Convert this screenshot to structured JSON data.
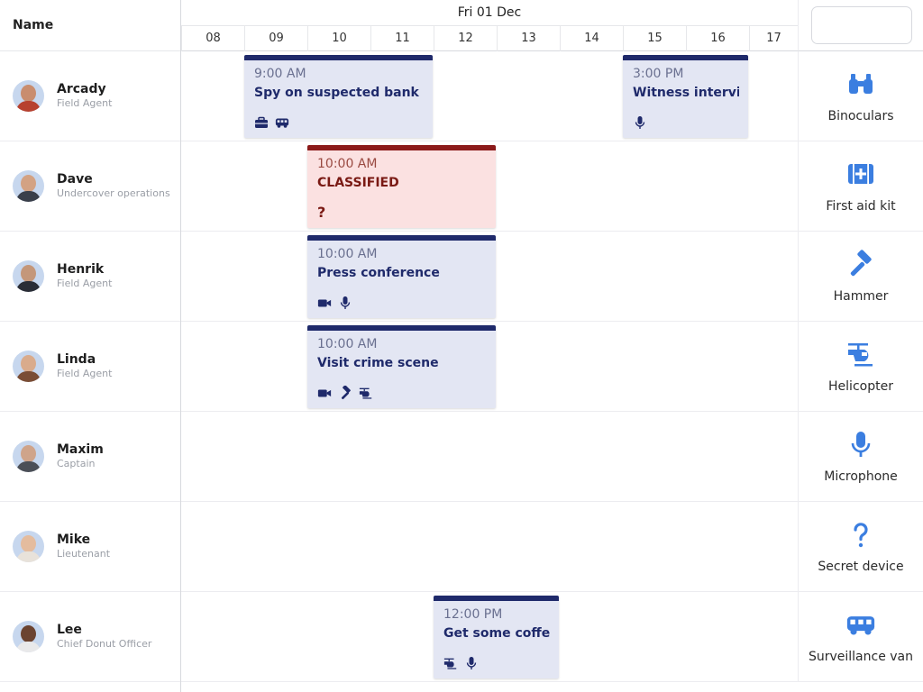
{
  "header": {
    "name_label": "Name",
    "date_label": "Fri 01 Dec",
    "hours": [
      "08",
      "09",
      "10",
      "11",
      "12",
      "13",
      "14",
      "15",
      "16",
      "17"
    ]
  },
  "equipment_search": {
    "value": "",
    "placeholder": ""
  },
  "resources": [
    {
      "name": "Arcady",
      "role": "Field Agent"
    },
    {
      "name": "Dave",
      "role": "Undercover operations"
    },
    {
      "name": "Henrik",
      "role": "Field Agent"
    },
    {
      "name": "Linda",
      "role": "Field Agent"
    },
    {
      "name": "Maxim",
      "role": "Captain"
    },
    {
      "name": "Mike",
      "role": "Lieutenant"
    },
    {
      "name": "Lee",
      "role": "Chief Donut Officer"
    }
  ],
  "events": [
    {
      "time": "9:00 AM",
      "title": "Spy on suspected bank robbers",
      "icons": [
        "toolbox-icon",
        "van-icon"
      ]
    },
    {
      "time": "3:00 PM",
      "title": "Witness interview",
      "icons": [
        "microphone-icon"
      ]
    },
    {
      "time": "10:00 AM",
      "title": "CLASSIFIED",
      "icons": [
        "question-icon"
      ]
    },
    {
      "time": "10:00 AM",
      "title": "Press conference",
      "icons": [
        "video-camera-icon",
        "microphone-icon"
      ]
    },
    {
      "time": "10:00 AM",
      "title": "Visit crime scene",
      "icons": [
        "video-camera-icon",
        "hammer-icon",
        "helicopter-icon"
      ]
    },
    {
      "time": "12:00 PM",
      "title": "Get some coffee",
      "icons": [
        "helicopter-icon",
        "microphone-icon"
      ]
    }
  ],
  "equipment": [
    {
      "label": "Binoculars",
      "icon": "binoculars-icon"
    },
    {
      "label": "First aid kit",
      "icon": "first-aid-kit-icon"
    },
    {
      "label": "Hammer",
      "icon": "hammer-icon"
    },
    {
      "label": "Helicopter",
      "icon": "helicopter-icon"
    },
    {
      "label": "Microphone",
      "icon": "microphone-icon"
    },
    {
      "label": "Secret device",
      "icon": "question-icon"
    },
    {
      "label": "Surveillance van",
      "icon": "van-icon"
    }
  ],
  "colors": {
    "event_bar": "#1f2a6b",
    "event_bg": "#e3e6f3",
    "classified_bar": "#8b1a1a",
    "classified_bg": "#fbe1e1",
    "equipment_icon": "#3b7ee0"
  }
}
